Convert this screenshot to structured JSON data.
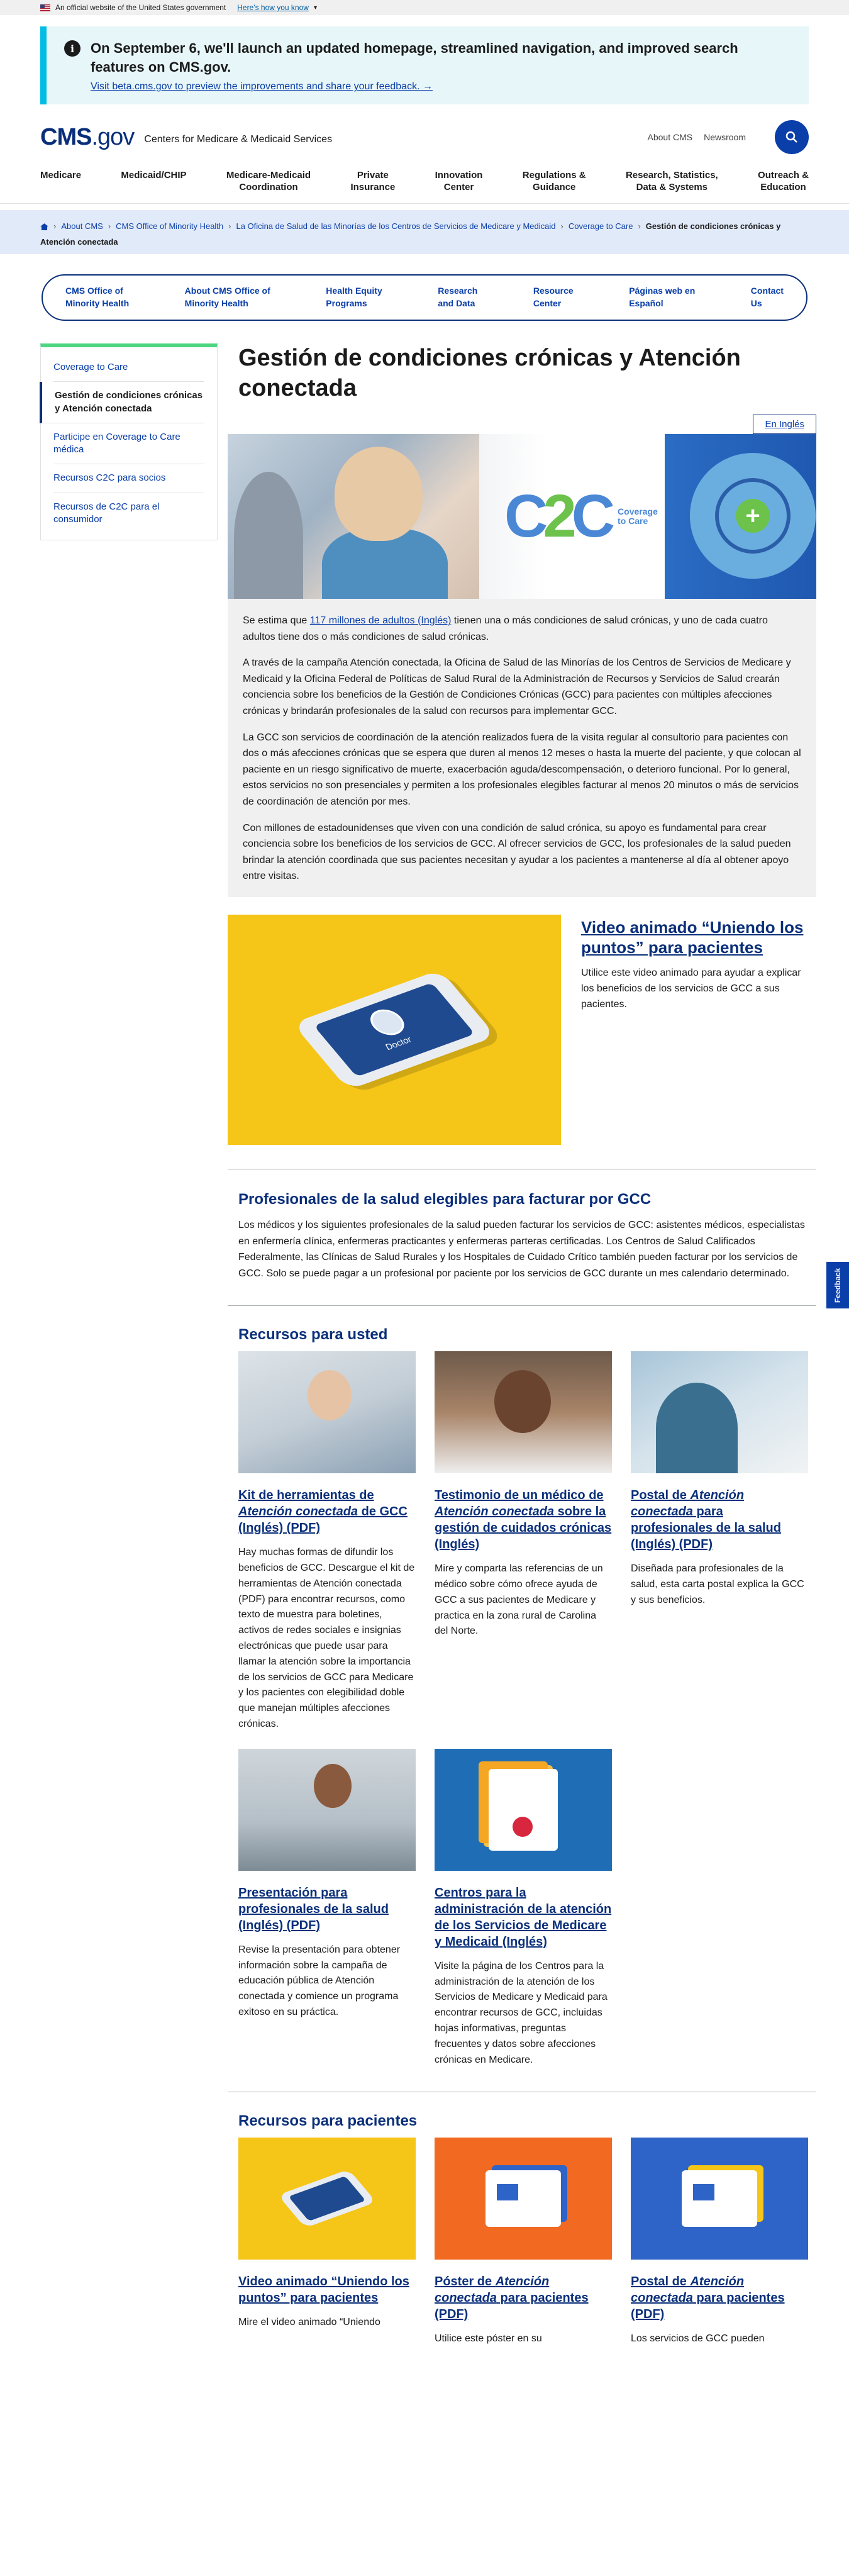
{
  "gov_banner": {
    "text": "An official website of the United States government",
    "link": "Here's how you know"
  },
  "alert": {
    "heading": "On September 6, we'll launch an updated homepage, streamlined navigation, and improved search features on CMS.gov.",
    "link": "Visit beta.cms.gov to preview the improvements and share your feedback."
  },
  "header": {
    "logo_main": "CMS",
    "logo_suffix": ".gov",
    "tagline": "Centers for Medicare & Medicaid Services",
    "about": "About CMS",
    "newsroom": "Newsroom"
  },
  "main_nav": [
    "Medicare",
    "Medicaid/CHIP",
    "Medicare-Medicaid\nCoordination",
    "Private\nInsurance",
    "Innovation\nCenter",
    "Regulations &\nGuidance",
    "Research, Statistics,\nData & Systems",
    "Outreach &\nEducation"
  ],
  "breadcrumb": {
    "items": [
      "About CMS",
      "CMS Office of Minority Health",
      "La Oficina de Salud de las Minorías de los Centros de Servicios de Medicare y Medicaid",
      "Coverage to Care"
    ],
    "current": "Gestión de condiciones crónicas y Atención conectada"
  },
  "subnav": [
    "CMS Office of\nMinority Health",
    "About CMS Office of\nMinority Health",
    "Health Equity\nPrograms",
    "Research\nand Data",
    "Resource\nCenter",
    "Páginas web en\nEspañol",
    "Contact\nUs"
  ],
  "sidenav": [
    "Coverage to Care",
    "Gestión de condiciones crónicas y Atención conectada",
    "Participe en Coverage to Care médica",
    "Recursos C2C para socios",
    "Recursos de C2C para el consumidor"
  ],
  "page": {
    "title": "Gestión de condiciones crónicas y Atención conectada",
    "lang_button": "En Inglés"
  },
  "hero": {
    "c2c_c1": "C",
    "c2c_2": "2",
    "c2c_c2": "C",
    "label": "Coverage\nto Care",
    "plus": "+"
  },
  "intro": {
    "p1_pre": "Se estima que ",
    "p1_link": "117 millones de adultos (Inglés)",
    "p1_post": " tienen una o más condiciones de salud crónicas, y uno de cada cuatro adultos tiene dos o más condiciones de salud crónicas.",
    "p2": "A través de la campaña Atención conectada, la Oficina de Salud de las Minorías de los Centros de Servicios de Medicare y Medicaid y la Oficina Federal de Políticas de Salud Rural de la Administración de Recursos y Servicios de Salud crearán conciencia sobre los beneficios de la Gestión de Condiciones Crónicas (GCC) para pacientes con múltiples afecciones crónicas y brindarán profesionales de la salud con recursos para implementar GCC.",
    "p3": "La GCC son servicios de coordinación de la atención realizados fuera de la visita regular al consultorio para pacientes con dos o más afecciones crónicas que se espera que duren al menos 12 meses o hasta la muerte del paciente, y que colocan al paciente en un riesgo significativo de muerte, exacerbación aguda/descompensación, o deterioro funcional. Por lo general, estos servicios no son presenciales y permiten a los profesionales elegibles facturar al menos 20 minutos o más de servicios de coordinación de atención por mes.",
    "p4": "Con millones de estadounidenses que viven con una condición de salud crónica, su apoyo es fundamental para crear conciencia sobre los beneficios de los servicios de GCC. Al ofrecer servicios de GCC, los profesionales de la salud pueden brindar la atención coordinada que sus pacientes necesitan y ayudar a los pacientes a mantenerse al día al obtener apoyo entre visitas."
  },
  "video": {
    "title": "Video animado “Uniendo los puntos” para pacientes",
    "desc": "Utilice este video animado para ayudar a explicar los beneficios de los servicios de GCC a sus pacientes.",
    "phone_text": "Doctor"
  },
  "eligible": {
    "heading": "Profesionales de la salud elegibles para facturar por GCC",
    "text": "Los médicos y los siguientes profesionales de la salud pueden facturar los servicios de GCC: asistentes médicos, especialistas en enfermería clínica, enfermeras practicantes y enfermeras parteras certificadas. Los Centros de Salud Calificados Federalmente, las Clínicas de Salud Rurales y los Hospitales de Cuidado Crítico también pueden facturar por los servicios de GCC. Solo se puede pagar a un profesional por paciente por los servicios de GCC durante un mes calendario determinado."
  },
  "resources": {
    "heading": "Recursos para usted",
    "cards": [
      {
        "title_pre": "Kit de herramientas de ",
        "title_em": "Atención conectada",
        "title_post": " de GCC (Inglés) (PDF)",
        "desc": "Hay muchas formas de difundir los beneficios de GCC. Descargue el kit de herramientas de Atención conectada (PDF) para encontrar recursos, como texto de muestra para boletines, activos de redes sociales e insignias electrónicas que puede usar para llamar la atención sobre la importancia de los servicios de GCC para Medicare y los pacientes con elegibilidad doble que manejan múltiples afecciones crónicas."
      },
      {
        "title_pre": "Testimonio de un médico de ",
        "title_em": "Atención conectada",
        "title_post": " sobre la gestión de cuidados crónicas (Inglés)",
        "desc": "Mire y comparta las referencias de un médico sobre cómo ofrece ayuda de GCC a sus pacientes de Medicare y practica en la zona rural de Carolina del Norte."
      },
      {
        "title_pre": "Postal de ",
        "title_em": "Atención conectada",
        "title_post": " para profesionales de la salud (Inglés) (PDF)",
        "desc": "Diseñada para profesionales de la salud, esta carta postal explica la GCC y sus beneficios."
      },
      {
        "title_pre": "Presentación para profesionales de la salud (Inglés) (PDF)",
        "title_em": "",
        "title_post": "",
        "desc": "Revise la presentación para obtener información sobre la campaña de educación pública de Atención conectada y comience un programa exitoso en su práctica."
      },
      {
        "title_pre": "Centros para la administración de la atención de los Servicios de Medicare y Medicaid (Inglés)",
        "title_em": "",
        "title_post": "",
        "desc": "Visite la página de los Centros para la administración de la atención de los Servicios de Medicare y Medicaid para encontrar recursos de GCC, incluidas hojas informativas, preguntas frecuentes y datos sobre afecciones crónicas en Medicare."
      }
    ]
  },
  "patients": {
    "heading": "Recursos para pacientes",
    "cards": [
      {
        "title_pre": "Video animado “Uniendo los puntos” para pacientes",
        "title_em": "",
        "title_post": "",
        "desc": "Mire el video animado “Uniendo"
      },
      {
        "title_pre": "Póster de ",
        "title_em": "Atención conectada",
        "title_post": " para pacientes (PDF)",
        "desc": "Utilice este póster en su"
      },
      {
        "title_pre": "Postal de ",
        "title_em": "Atención conectada",
        "title_post": " para pacientes (PDF)",
        "desc": "Los servicios de GCC pueden"
      }
    ]
  },
  "feedback": "Feedback"
}
